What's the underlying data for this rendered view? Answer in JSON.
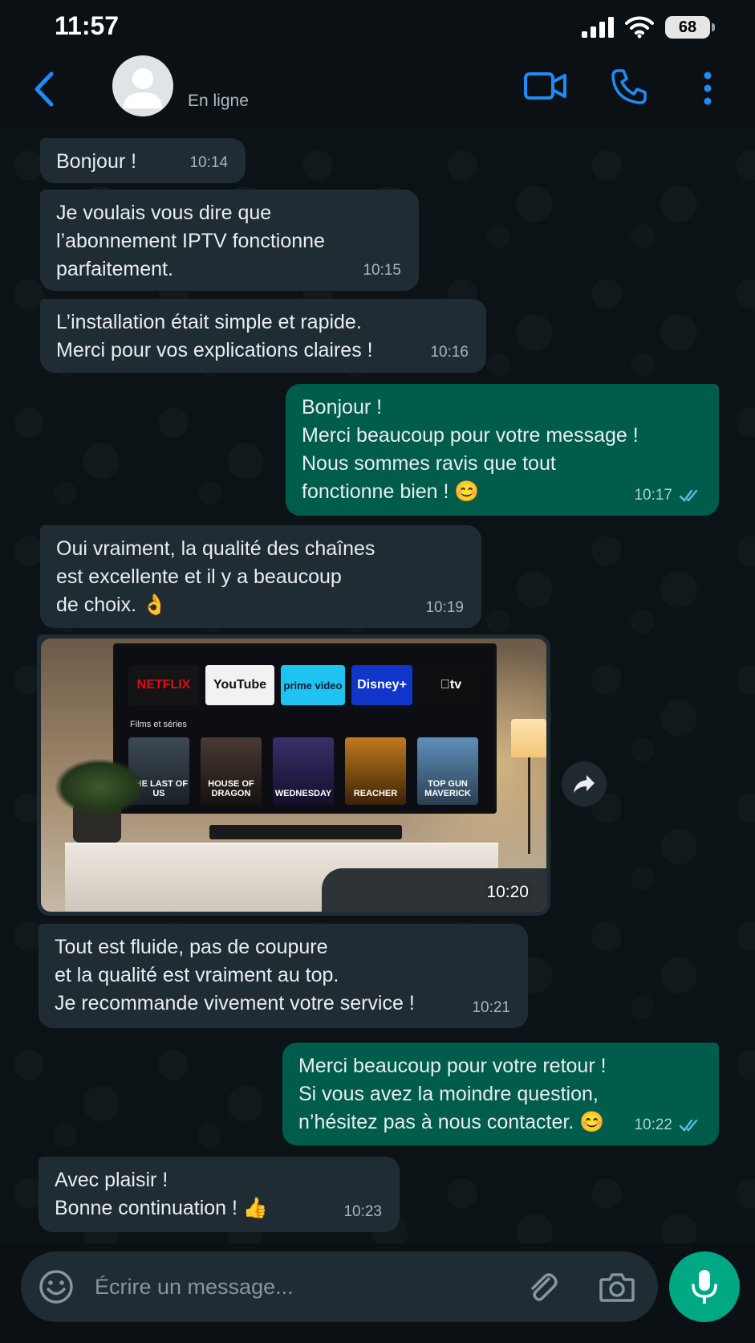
{
  "status_bar": {
    "time": "11:57",
    "battery": "68"
  },
  "header": {
    "contact_name": "",
    "contact_status": "En ligne"
  },
  "messages": [
    {
      "dir": "in",
      "text": "Bonjour !",
      "time": "10:14"
    },
    {
      "dir": "in",
      "text": "Je voulais vous dire que\nl’abonnement IPTV fonctionne\nparfaitement.",
      "time": "10:15"
    },
    {
      "dir": "in",
      "text": "L’installation était simple et rapide.\nMerci pour vos explications claires !",
      "time": "10:16"
    },
    {
      "dir": "out",
      "text": "Bonjour !\nMerci beaucoup pour votre message !\nNous sommes ravis que tout\nfonctionne bien ! 😊",
      "time": "10:17"
    },
    {
      "dir": "in",
      "text": "Oui vraiment, la qualité des chaînes\nest excellente et il y a beaucoup\nde choix. 👌",
      "time": "10:19"
    },
    {
      "dir": "in",
      "text": "Tout est fluide, pas de coupure\net la qualité est vraiment au top.\nJe recommande vivement votre service !",
      "time": "10:21"
    },
    {
      "dir": "out",
      "text": "Merci beaucoup pour votre retour !\nSi vous avez la moindre question,\nn’hésitez pas à nous contacter. 😊",
      "time": "10:22"
    },
    {
      "dir": "in",
      "text": "Avec plaisir !\nBonne continuation ! 👍",
      "time": "10:23"
    }
  ],
  "image_message": {
    "time": "10:20",
    "apps": [
      "NETFLIX",
      "YouTube",
      "prime video",
      "Disney+",
      "tv"
    ],
    "row_label": "Films et séries",
    "posters": [
      "THE LAST OF US",
      "HOUSE OF DRAGON",
      "WEDNESDAY",
      "REACHER",
      "TOP GUN MAVERICK"
    ]
  },
  "composer": {
    "placeholder": "Écrire un message..."
  },
  "colors": {
    "accent": "#1d8cf8",
    "outgoing": "#005c4b",
    "incoming": "#202c33",
    "mic": "#00a884"
  }
}
